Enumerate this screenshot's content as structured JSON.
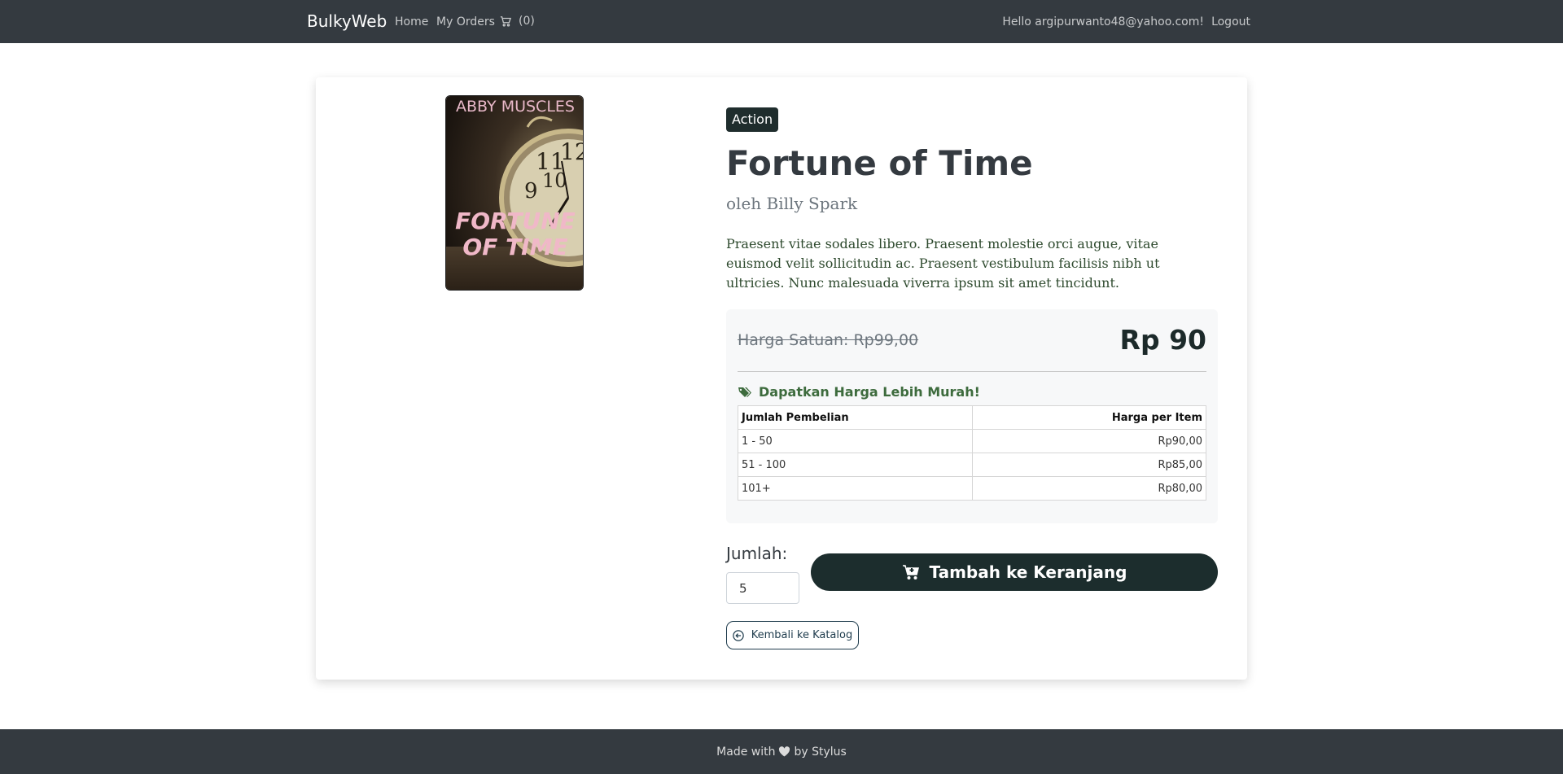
{
  "nav": {
    "brand": "BulkyWeb",
    "home": "Home",
    "orders": "My Orders",
    "cart_count": "(0)",
    "hello": "Hello argipurwanto48@yahoo.com!",
    "logout": "Logout"
  },
  "product": {
    "cover_top_text": "ABBY MUSCLES",
    "cover_title_line1": "FORTUNE",
    "cover_title_line2": "OF TIME",
    "category": "Action",
    "title": "Fortune of Time",
    "author": "oleh Billy Spark",
    "description": "Praesent vitae sodales libero. Praesent molestie orci augue, vitae euismod velit sollicitudin ac. Praesent vestibulum facilisis nibh ut ultricies. Nunc malesuada viverra ipsum sit amet tincidunt."
  },
  "pricing": {
    "list_price": "Harga Satuan: Rp99,00",
    "price": "Rp 90",
    "promo": "Dapatkan Harga Lebih Murah!",
    "table_headers": [
      "Jumlah Pembelian",
      "Harga per Item"
    ],
    "tiers": [
      {
        "qty": "1 - 50",
        "price": "Rp90,00"
      },
      {
        "qty": "51 - 100",
        "price": "Rp85,00"
      },
      {
        "qty": "101+",
        "price": "Rp80,00"
      }
    ]
  },
  "order": {
    "qty_label": "Jumlah:",
    "qty_value": "5",
    "add_button": "Tambah ke Keranjang",
    "back_button": "Kembali ke Katalog"
  },
  "footer": {
    "made_with": "Made with",
    "by": "by Stylus"
  },
  "colors": {
    "navbar": "#343a40",
    "primary_button": "#1c2d2d",
    "promo": "#3d6b3d"
  }
}
